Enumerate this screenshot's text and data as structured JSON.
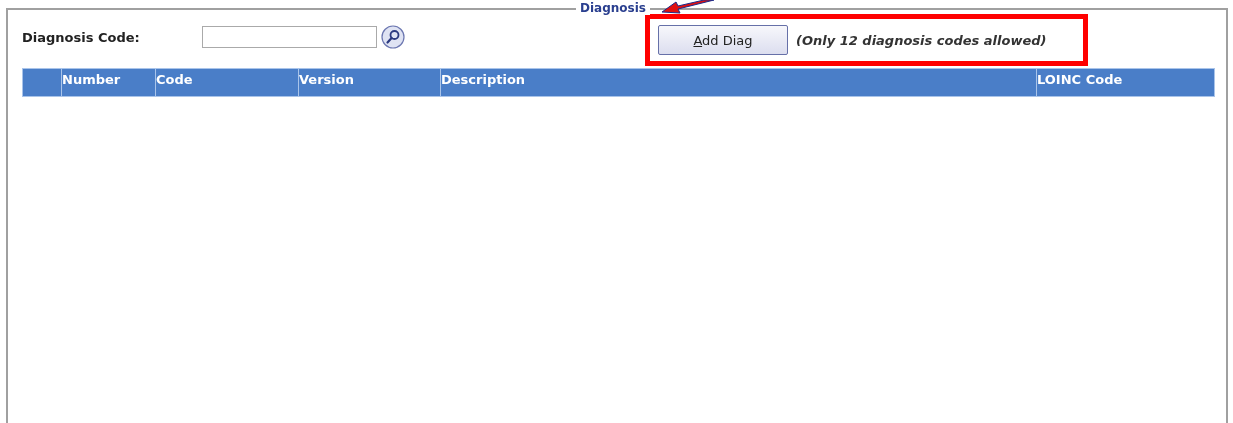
{
  "panel": {
    "legend": "Diagnosis"
  },
  "search": {
    "label": "Diagnosis Code:"
  },
  "add_button": {
    "label": "Add Diag",
    "access_key_underlined": true
  },
  "note": "(Only 12 diagnosis codes allowed)",
  "table": {
    "columns": [
      {
        "label": "Number"
      },
      {
        "label": "Code"
      },
      {
        "label": "Version"
      },
      {
        "label": "Description"
      },
      {
        "label": "LOINC Code"
      }
    ]
  }
}
